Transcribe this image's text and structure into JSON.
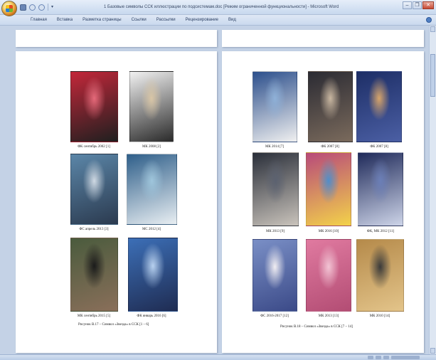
{
  "window": {
    "title": "1 Базовые символы ССК иллюстрации по подсистемам.doc [Режим ограниченной функциональности] - Microsoft Word"
  },
  "ribbon": {
    "tabs": [
      {
        "label": "Главная"
      },
      {
        "label": "Вставка"
      },
      {
        "label": "Разметка страницы"
      },
      {
        "label": "Ссылки"
      },
      {
        "label": "Рассылки"
      },
      {
        "label": "Рецензирование"
      },
      {
        "label": "Вид"
      }
    ]
  },
  "left_page": {
    "photos": [
      {
        "caption": "ФК сентябрь 2002 [1]",
        "colors": [
          "#c3273a",
          "#e56a7a",
          "#1f1f1f"
        ]
      },
      {
        "caption": "МК 2008 [2]",
        "colors": [
          "#f2f2f2",
          "#d9c6a6",
          "#2a2a2a"
        ]
      },
      {
        "caption": "ФС апрель 2013 [3]",
        "colors": [
          "#5b86a8",
          "#cfd9e3",
          "#2b3a4f"
        ]
      },
      {
        "caption": "МС 2012 [4]",
        "colors": [
          "#2f5f8a",
          "#9fc6dc",
          "#e8eef2"
        ]
      },
      {
        "caption": "МК сентябрь 2015 [5]",
        "colors": [
          "#4a5b3d",
          "#1b1b1b",
          "#8a6f5a"
        ]
      },
      {
        "caption": "ФК январь 2016 [6]",
        "colors": [
          "#3c6fb7",
          "#b8d1ef",
          "#1f2c52"
        ]
      }
    ],
    "figure_caption": "Рисунок В.17 – Символ «Звезда» в ССК [1 – 6]"
  },
  "right_page": {
    "photos": [
      {
        "caption": "МК 2014 [7]",
        "colors": [
          "#2c4f8c",
          "#8fb1d8",
          "#f0f0f0"
        ]
      },
      {
        "caption": "ФК 2007 [8]",
        "colors": [
          "#2b2b33",
          "#c9b7a1",
          "#7a6a5c"
        ]
      },
      {
        "caption": "ФК 2007 [8]",
        "colors": [
          "#1d2e66",
          "#d8a56a",
          "#4b5fa4"
        ]
      },
      {
        "caption": "МК 2013 [9]",
        "colors": [
          "#2a2f3a",
          "#5b6170",
          "#c9c3bb"
        ]
      },
      {
        "caption": "МК 2016 [10]",
        "colors": [
          "#b84a7a",
          "#4f8ecb",
          "#f3d24a"
        ]
      },
      {
        "caption": "ФК, МК 2012 [11]",
        "colors": [
          "#1f2a5a",
          "#6b7fb8",
          "#cdd4e8"
        ]
      },
      {
        "caption": "ФС 2016-2017 [12]",
        "colors": [
          "#7a8fc6",
          "#f1eef2",
          "#3b4a88"
        ]
      },
      {
        "caption": "МК 2013 [13]",
        "colors": [
          "#e07aa0",
          "#f2c4d4",
          "#b34d74"
        ]
      },
      {
        "caption": "МК 2010 [14]",
        "colors": [
          "#b58a4a",
          "#3a3a3a",
          "#e3c48a"
        ]
      }
    ],
    "figure_caption": "Рисунок В.18 – Символ «Звезда» в ССК [7 – 14]"
  }
}
